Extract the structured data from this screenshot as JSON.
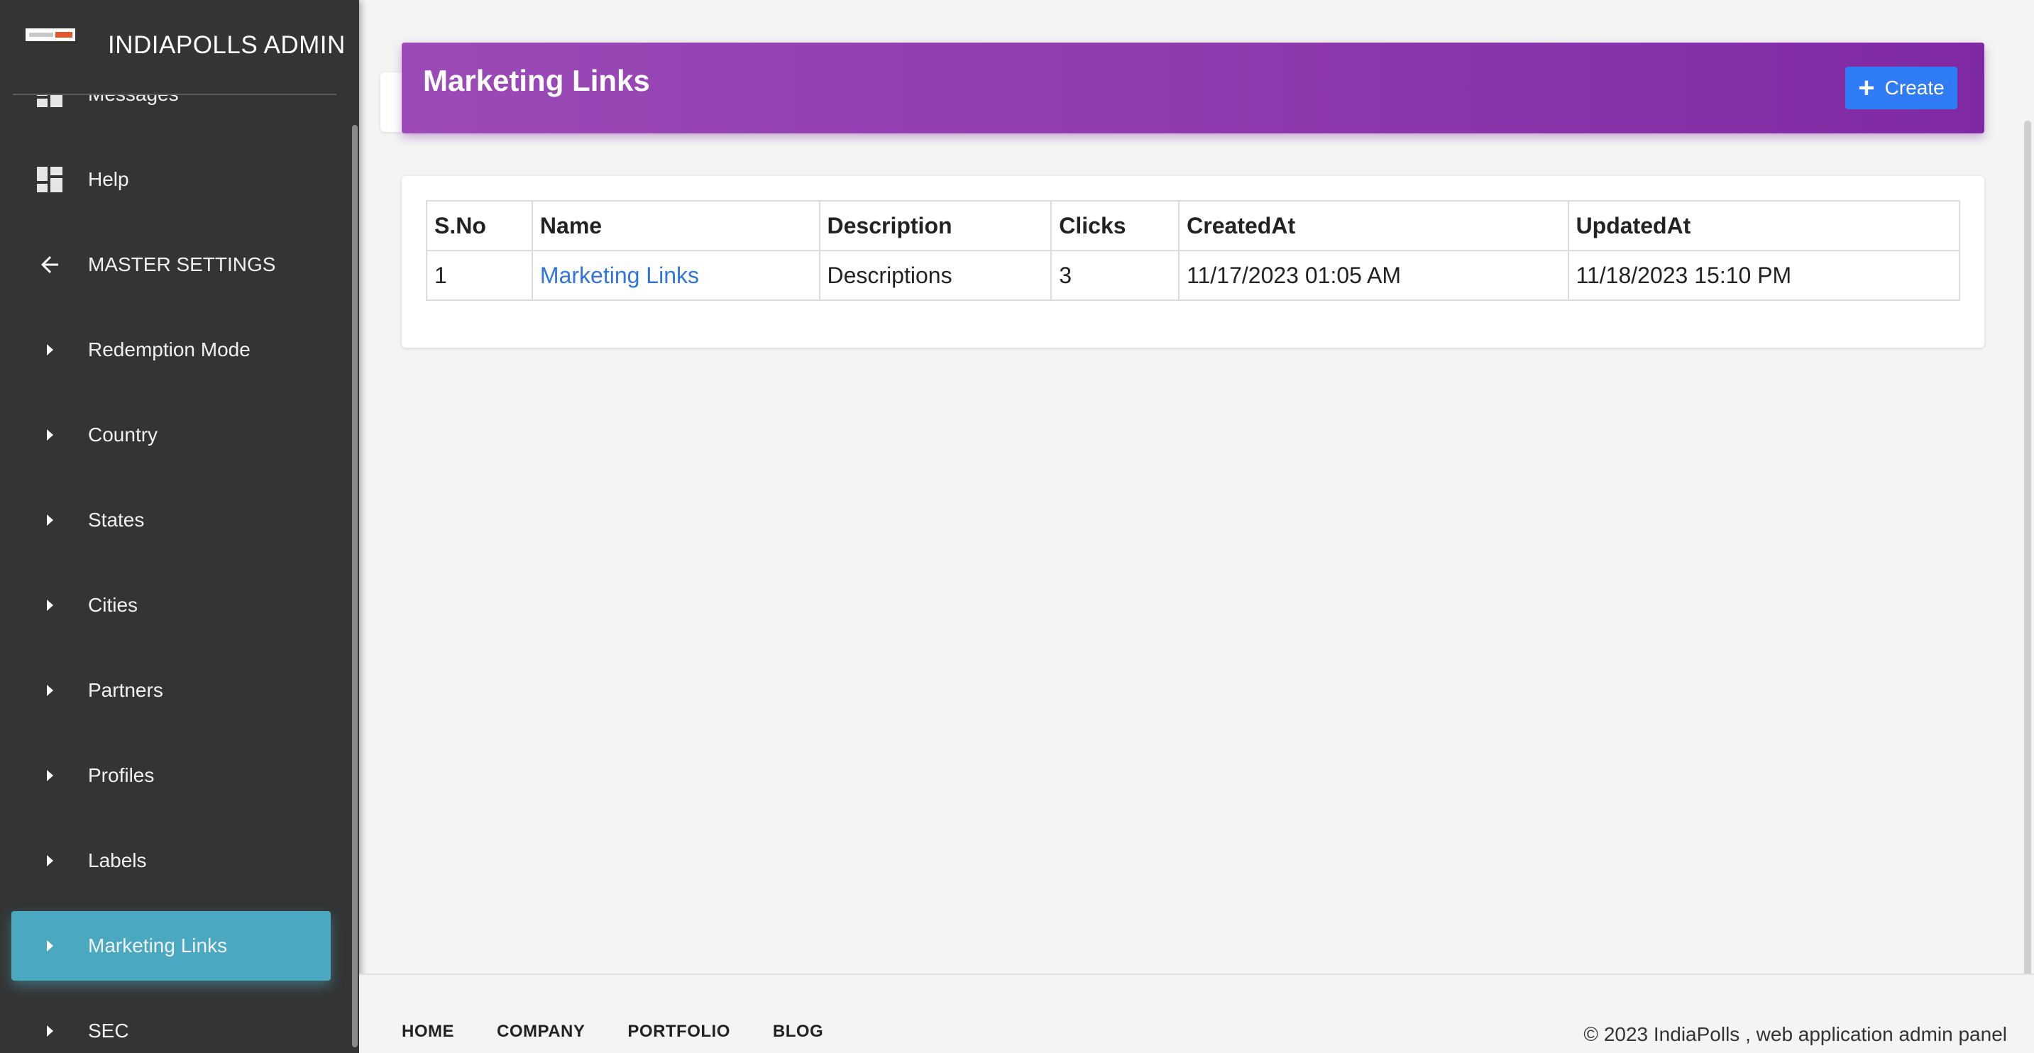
{
  "brand": {
    "title": "INDIAPOLLS ADMIN"
  },
  "sidebar": {
    "items": [
      {
        "label": "Messages",
        "icon": "dashboard-icon"
      },
      {
        "label": "Help",
        "icon": "dashboard-icon"
      },
      {
        "label": "MASTER SETTINGS",
        "icon": "arrow-left-icon"
      },
      {
        "label": "Redemption Mode",
        "icon": "caret-right-icon"
      },
      {
        "label": "Country",
        "icon": "caret-right-icon"
      },
      {
        "label": "States",
        "icon": "caret-right-icon"
      },
      {
        "label": "Cities",
        "icon": "caret-right-icon"
      },
      {
        "label": "Partners",
        "icon": "caret-right-icon"
      },
      {
        "label": "Profiles",
        "icon": "caret-right-icon"
      },
      {
        "label": "Labels",
        "icon": "caret-right-icon"
      },
      {
        "label": "Marketing Links",
        "icon": "caret-right-icon",
        "active": true
      },
      {
        "label": "SEC",
        "icon": "caret-right-icon"
      }
    ]
  },
  "header": {
    "title": "Marketing Links",
    "create_label": "Create",
    "banner_color": "#8b38ac",
    "button_color": "#2f7cf6"
  },
  "table": {
    "columns": [
      "S.No",
      "Name",
      "Description",
      "Clicks",
      "CreatedAt",
      "UpdatedAt"
    ],
    "rows": [
      [
        "1",
        "Marketing Links",
        "Descriptions",
        "3",
        "11/17/2023 01:05 AM",
        "11/18/2023 15:10 PM"
      ]
    ]
  },
  "footer": {
    "links": [
      "HOME",
      "COMPANY",
      "PORTFOLIO",
      "BLOG"
    ],
    "copyright": "© 2023 IndiaPolls , web application admin panel"
  }
}
